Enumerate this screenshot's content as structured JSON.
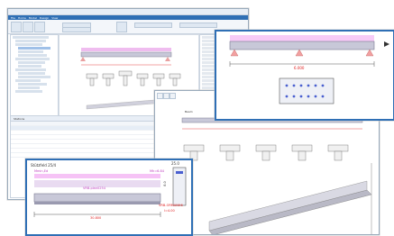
{
  "main_window": {
    "tabs": [
      "File",
      "Home",
      "Model",
      "Design",
      "View"
    ],
    "grid_title": "Stations"
  },
  "detail_window": {
    "header_label": "Beam"
  },
  "popup_right": {
    "dim_total": "6.000"
  },
  "popup_left": {
    "title": "Stützfeld 25/4",
    "moment_left": "Mmin,Ed",
    "moment_right": "Mh=6.84",
    "beam_label": "VRB-plan0254",
    "section_width": "25.0",
    "section_height": "8.0",
    "annotation": "VRB-ORMANH6",
    "annotation_value": "l=4.00",
    "dim_total": "30.800"
  },
  "colors": {
    "accent": "#2f6fb5",
    "load": "#e58fe5",
    "beam_top": "#c8c8d8",
    "beam_bottom": "#9a9ab0",
    "dim_red": "#e02020",
    "rebar": "#4a5fd0"
  }
}
